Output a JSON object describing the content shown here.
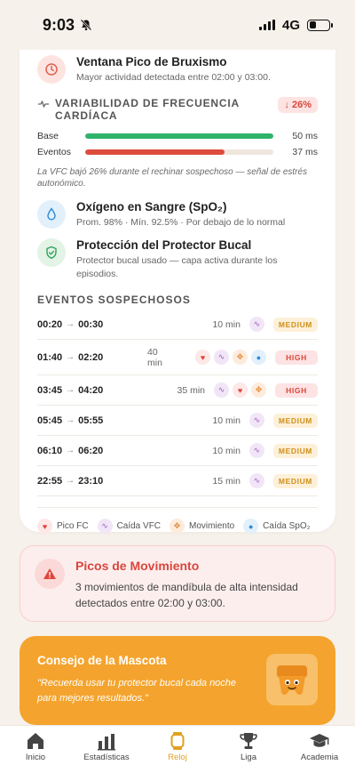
{
  "status_bar": {
    "time": "9:03",
    "network": "4G"
  },
  "peak_window": {
    "title": "Ventana Pico de Bruxismo",
    "subtitle": "Mayor actividad detectada entre 02:00 y 03:00."
  },
  "vfc": {
    "title": "VARIABILIDAD DE FRECUENCIA CARDÍACA",
    "change_badge": "↓ 26%",
    "base": {
      "label": "Base",
      "value": "50 ms",
      "level": 1.0
    },
    "events": {
      "label": "Eventos",
      "value": "37 ms",
      "level": 0.74
    },
    "note": "La VFC bajó 26% durante el rechinar sospechoso — señal de estrés autonómico."
  },
  "oxygen": {
    "title": "Oxígeno en Sangre (SpO₂)",
    "subtitle": "Prom. 98% · Mín. 92.5% · Por debajo de lo normal"
  },
  "guard": {
    "title": "Protección del Protector Bucal",
    "subtitle": "Protector bucal usado — capa activa durante los episodios."
  },
  "events": {
    "title": "EVENTOS SOSPECHOSOS",
    "rows": [
      {
        "start": "00:20",
        "end": "00:30",
        "duration": "10 min",
        "severity": "MEDIUM",
        "signals": [
          "vfc"
        ]
      },
      {
        "start": "01:40",
        "end": "02:20",
        "duration": "40 min",
        "severity": "HIGH",
        "signals": [
          "hr",
          "vfc",
          "mov",
          "spo"
        ]
      },
      {
        "start": "03:45",
        "end": "04:20",
        "duration": "35 min",
        "severity": "HIGH",
        "signals": [
          "vfc",
          "hr",
          "mov"
        ]
      },
      {
        "start": "05:45",
        "end": "05:55",
        "duration": "10 min",
        "severity": "MEDIUM",
        "signals": [
          "vfc"
        ]
      },
      {
        "start": "06:10",
        "end": "06:20",
        "duration": "10 min",
        "severity": "MEDIUM",
        "signals": [
          "vfc"
        ]
      },
      {
        "start": "22:55",
        "end": "23:10",
        "duration": "15 min",
        "severity": "MEDIUM",
        "signals": [
          "vfc"
        ]
      }
    ]
  },
  "legend": {
    "hr": "Pico FC",
    "vfc": "Caída VFC",
    "mov": "Movimiento",
    "spo": "Caída SpO₂"
  },
  "movement_alert": {
    "title": "Picos de Movimiento",
    "text": "3 movimientos de mandíbula de alta intensidad detectados entre 02:00 y 03:00."
  },
  "mascot_tip": {
    "title": "Consejo de la Mascota",
    "text": "\"Recuerda usar tu protector bucal cada noche para mejores resultados.\""
  },
  "nav": [
    {
      "label": "Inicio",
      "icon": "home-icon"
    },
    {
      "label": "Estadísticas",
      "icon": "chart-icon"
    },
    {
      "label": "Reloj",
      "icon": "watch-icon",
      "active": true
    },
    {
      "label": "Liga",
      "icon": "trophy-icon"
    },
    {
      "label": "Academia",
      "icon": "graduation-cap-icon"
    }
  ],
  "colors": {
    "accent": "#e0a020",
    "base_bar": "#2fb36b",
    "events_bar": "#dc4b3e",
    "high": "#d9463b",
    "medium": "#d08f1a"
  }
}
